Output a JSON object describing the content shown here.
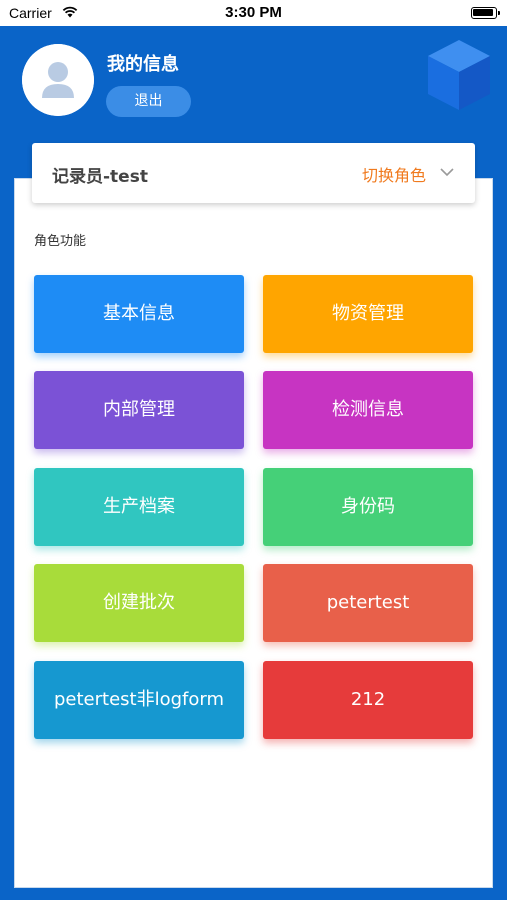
{
  "status": {
    "carrier": "Carrier",
    "time": "3:30 PM"
  },
  "user": {
    "name": "我的信息",
    "logout_label": "退出"
  },
  "role": {
    "name": "记录员-test",
    "switch_label": "切换角色"
  },
  "section_title": "角色功能",
  "tiles": [
    {
      "label": "基本信息",
      "color": "#1e8cf5"
    },
    {
      "label": "物资管理",
      "color": "#ffa500"
    },
    {
      "label": "内部管理",
      "color": "#7b52d6"
    },
    {
      "label": "检测信息",
      "color": "#c734c2"
    },
    {
      "label": "生产档案",
      "color": "#30c6c0"
    },
    {
      "label": "身份码",
      "color": "#45d078"
    },
    {
      "label": "创建批次",
      "color": "#a8dc3a"
    },
    {
      "label": "petertest",
      "color": "#e8604a"
    },
    {
      "label": "petertest非logform",
      "color": "#1698d0"
    },
    {
      "label": "212",
      "color": "#e63b3b"
    }
  ],
  "colors": {
    "header_blue": "#0a64c8",
    "accent_orange": "#f07a1e"
  }
}
